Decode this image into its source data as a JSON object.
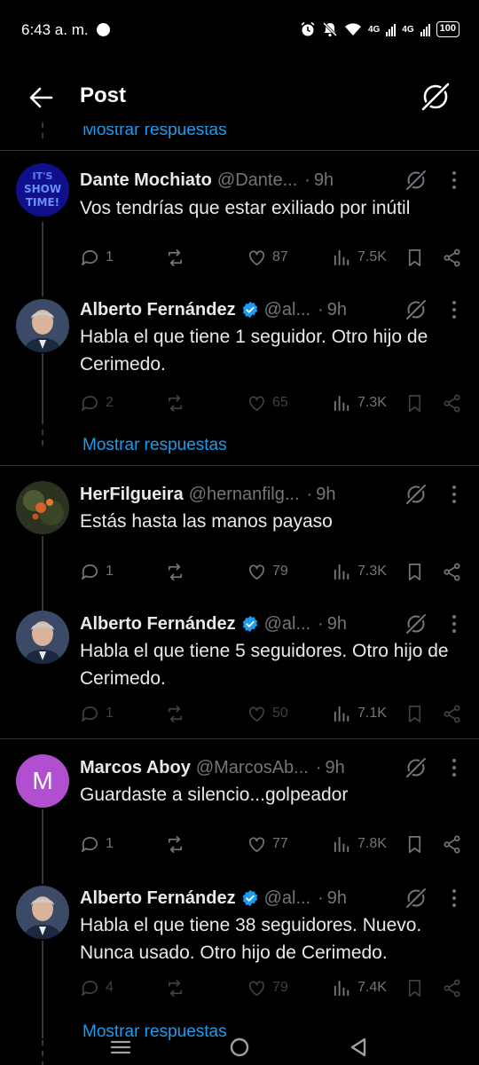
{
  "status_bar": {
    "time": "6:43 a. m.",
    "net1": "4G",
    "net2": "4G",
    "battery": "100"
  },
  "header": {
    "title": "Post"
  },
  "top_show_replies": "Mostrar respuestas",
  "tweets": [
    {
      "name": "Dante Mochiato",
      "handle": "@Dante...",
      "dot": "·",
      "time": "9h",
      "text": "Vos tendrías que estar exiliado por inútil",
      "replies": "1",
      "likes": "87",
      "views": "7.5K",
      "avatar": "show-time-avatar"
    },
    {
      "name": "Alberto Fernández",
      "handle": "@al...",
      "dot": "·",
      "time": "9h",
      "text": "Habla el que tiene 1 seguidor. Otro hijo de Cerimedo.",
      "replies": "2",
      "likes": "65",
      "views": "7.3K",
      "verified": true
    },
    {
      "name": "HerFilgueira",
      "handle": "@hernanfilg...",
      "dot": "·",
      "time": "9h",
      "text": "Estás hasta las manos payaso",
      "replies": "1",
      "likes": "79",
      "views": "7.3K"
    },
    {
      "name": "Alberto Fernández",
      "handle": "@al...",
      "dot": "·",
      "time": "9h",
      "text": "Habla el que tiene 5 seguidores. Otro hijo de Cerimedo.",
      "replies": "1",
      "likes": "50",
      "views": "7.1K",
      "verified": true
    },
    {
      "name": "Marcos Aboy",
      "handle": "@MarcosAb...",
      "dot": "·",
      "time": "9h",
      "text": "Guardaste a silencio...golpeador",
      "replies": "1",
      "likes": "77",
      "views": "7.8K",
      "avatar_letter": "M"
    },
    {
      "name": "Alberto Fernández",
      "handle": "@al...",
      "dot": "·",
      "time": "9h",
      "text": "Habla el que tiene 38 seguidores. Nuevo. Nunca usado. Otro hijo de Cerimedo.",
      "replies": "4",
      "likes": "79",
      "views": "7.4K",
      "verified": true
    }
  ],
  "show_replies": "Mostrar respuestas",
  "colors": {
    "accent": "#1d9bf0",
    "muted": "#71767b",
    "background": "#000000",
    "avatar_purple": "#b14fd1"
  }
}
